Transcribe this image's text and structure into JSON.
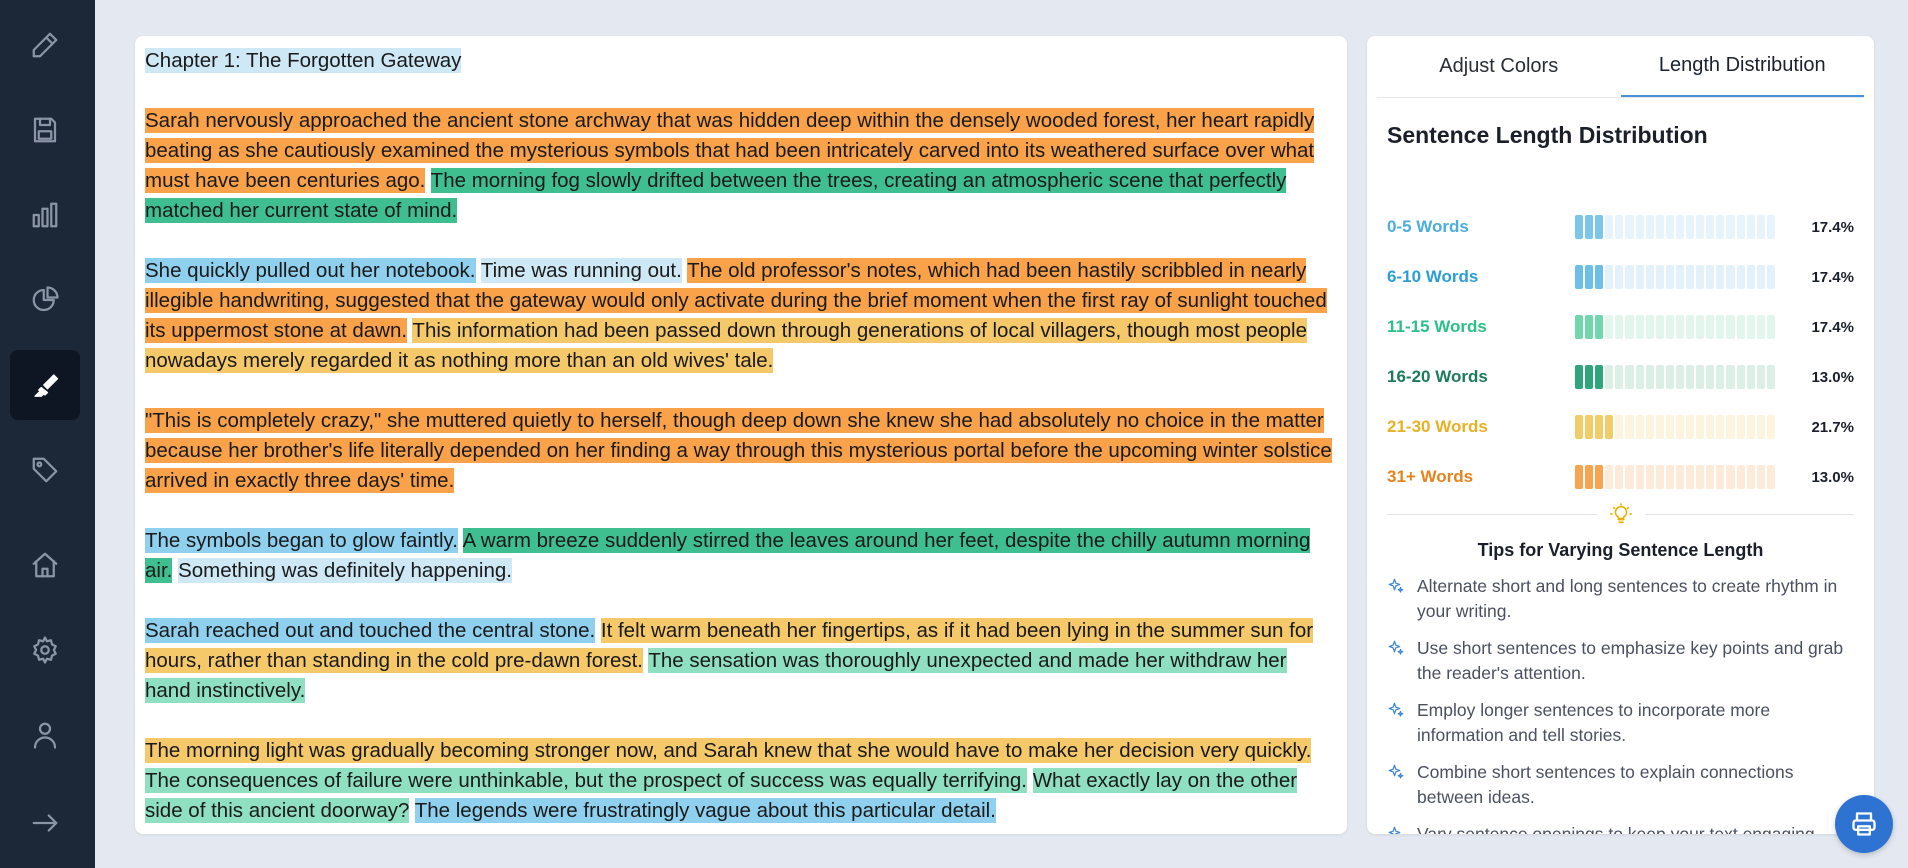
{
  "sidebar": {
    "items": [
      {
        "icon": "pencil-icon",
        "active": false
      },
      {
        "icon": "save-icon",
        "active": false
      },
      {
        "icon": "bar-chart-icon",
        "active": false
      },
      {
        "icon": "pie-chart-icon",
        "active": false
      },
      {
        "icon": "highlighter-icon",
        "active": true
      },
      {
        "icon": "tag-icon",
        "active": false
      },
      {
        "icon": "home-icon",
        "active": false
      },
      {
        "icon": "gear-icon",
        "active": false
      },
      {
        "icon": "user-icon",
        "active": false
      },
      {
        "icon": "arrow-right-icon",
        "active": false
      }
    ]
  },
  "editor": {
    "paragraphs": [
      {
        "title": true,
        "sentences": [
          {
            "text": "Chapter 1: The Forgotten Gateway",
            "c": "c1"
          }
        ]
      },
      {
        "sentences": [
          {
            "text": "Sarah nervously approached the ancient stone archway that was hidden deep within the densely wooded forest, her heart rapidly beating as she cautiously examined the mysterious symbols that had been intricately carved into its weathered surface over what must have been centuries ago.",
            "c": "c6"
          },
          {
            "text": "The morning fog slowly drifted between the trees, creating an atmospheric scene that perfectly matched her current state of mind.",
            "c": "c4"
          }
        ]
      },
      {
        "sentences": [
          {
            "text": "She quickly pulled out her notebook.",
            "c": "c2"
          },
          {
            "text": "Time was running out.",
            "c": "c1"
          },
          {
            "text": "The old professor's notes, which had been hastily scribbled in nearly illegible handwriting, suggested that the gateway would only activate during the brief moment when the first ray of sunlight touched its uppermost stone at dawn.",
            "c": "c6"
          },
          {
            "text": "This information had been passed down through generations of local villagers, though most people nowadays merely regarded it as nothing more than an old wives' tale.",
            "c": "c5"
          }
        ]
      },
      {
        "sentences": [
          {
            "text": "\"This is completely crazy,\" she muttered quietly to herself, though deep down she knew she had absolutely no choice in the matter because her brother's life literally depended on her finding a way through this mysterious portal before the upcoming winter solstice arrived in exactly three days' time.",
            "c": "c6"
          }
        ]
      },
      {
        "sentences": [
          {
            "text": "The symbols began to glow faintly.",
            "c": "c2"
          },
          {
            "text": "A warm breeze suddenly stirred the leaves around her feet, despite the chilly autumn morning air.",
            "c": "c4"
          },
          {
            "text": "Something was definitely happening.",
            "c": "c1"
          }
        ]
      },
      {
        "sentences": [
          {
            "text": "Sarah reached out and touched the central stone.",
            "c": "c2"
          },
          {
            "text": "It felt warm beneath her fingertips, as if it had been lying in the summer sun for hours, rather than standing in the cold pre-dawn forest.",
            "c": "c5"
          },
          {
            "text": "The sensation was thoroughly unexpected and made her withdraw her hand instinctively.",
            "c": "c3"
          }
        ]
      },
      {
        "sentences": [
          {
            "text": "The morning light was gradually becoming stronger now, and Sarah knew that she would have to make her decision very quickly.",
            "c": "c5"
          },
          {
            "text": "The consequences of failure were unthinkable, but the prospect of success was equally terrifying.",
            "c": "c3"
          },
          {
            "text": "What exactly lay on the other side of this ancient doorway?",
            "c": "c3"
          },
          {
            "text": "The legends were frustratingly vague about this particular detail.",
            "c": "c2"
          }
        ]
      }
    ]
  },
  "panel": {
    "tabs": [
      "Adjust Colors",
      "Length Distribution"
    ],
    "active_tab": 1,
    "title": "Sentence Length Distribution",
    "distribution": [
      {
        "label": "0-5 Words",
        "percent": 17.4,
        "percent_text": "17.4%",
        "color": "#7cc6ea",
        "light": "#e8f4fb",
        "label_color": "#4aaedf"
      },
      {
        "label": "6-10 Words",
        "percent": 17.4,
        "percent_text": "17.4%",
        "color": "#6cc0e8",
        "light": "#e3f2fa",
        "label_color": "#2a9fd6"
      },
      {
        "label": "11-15 Words",
        "percent": 17.4,
        "percent_text": "17.4%",
        "color": "#6fd6ad",
        "light": "#e2f6ee",
        "label_color": "#2bbf8a"
      },
      {
        "label": "16-20 Words",
        "percent": 13.0,
        "percent_text": "13.0%",
        "color": "#2fa57b",
        "light": "#dcefe7",
        "label_color": "#1d7a5a"
      },
      {
        "label": "21-30 Words",
        "percent": 21.7,
        "percent_text": "21.7%",
        "color": "#f3cc6a",
        "light": "#fdf4de",
        "label_color": "#e8b022"
      },
      {
        "label": "31+ Words",
        "percent": 13.0,
        "percent_text": "13.0%",
        "color": "#f7a34f",
        "light": "#fdebd9",
        "label_color": "#e8821a"
      }
    ],
    "tips_title": "Tips for Varying Sentence Length",
    "tips": [
      "Alternate short and long sentences to create rhythm in your writing.",
      "Use short sentences to emphasize key points and grab the reader's attention.",
      "Employ longer sentences to incorporate more information and tell stories.",
      "Combine short sentences to explain connections between ideas.",
      "Vary sentence openings to keep your text engaging."
    ]
  },
  "fab": {
    "icon": "print-icon"
  }
}
